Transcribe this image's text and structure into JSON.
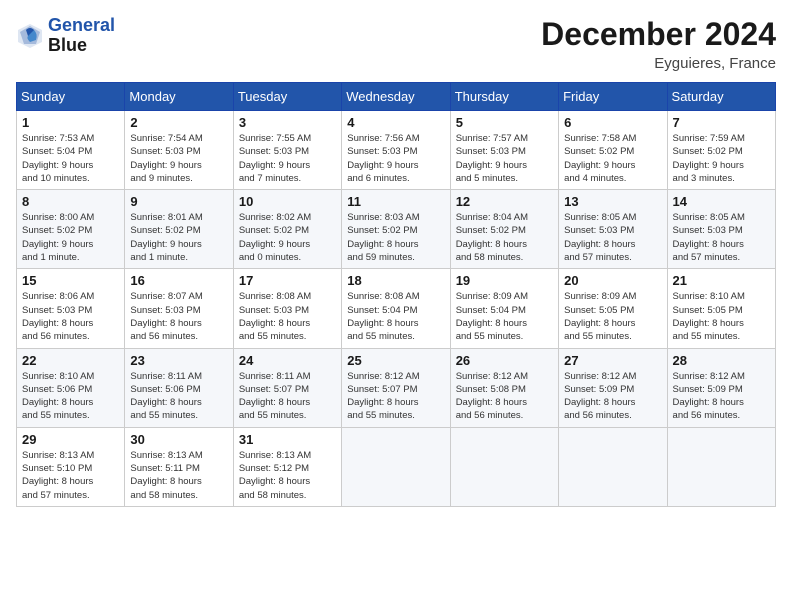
{
  "header": {
    "logo_line1": "General",
    "logo_line2": "Blue",
    "month_year": "December 2024",
    "location": "Eyguieres, France"
  },
  "weekdays": [
    "Sunday",
    "Monday",
    "Tuesday",
    "Wednesday",
    "Thursday",
    "Friday",
    "Saturday"
  ],
  "weeks": [
    [
      {
        "day": "1",
        "info": "Sunrise: 7:53 AM\nSunset: 5:04 PM\nDaylight: 9 hours\nand 10 minutes."
      },
      {
        "day": "2",
        "info": "Sunrise: 7:54 AM\nSunset: 5:03 PM\nDaylight: 9 hours\nand 9 minutes."
      },
      {
        "day": "3",
        "info": "Sunrise: 7:55 AM\nSunset: 5:03 PM\nDaylight: 9 hours\nand 7 minutes."
      },
      {
        "day": "4",
        "info": "Sunrise: 7:56 AM\nSunset: 5:03 PM\nDaylight: 9 hours\nand 6 minutes."
      },
      {
        "day": "5",
        "info": "Sunrise: 7:57 AM\nSunset: 5:03 PM\nDaylight: 9 hours\nand 5 minutes."
      },
      {
        "day": "6",
        "info": "Sunrise: 7:58 AM\nSunset: 5:02 PM\nDaylight: 9 hours\nand 4 minutes."
      },
      {
        "day": "7",
        "info": "Sunrise: 7:59 AM\nSunset: 5:02 PM\nDaylight: 9 hours\nand 3 minutes."
      }
    ],
    [
      {
        "day": "8",
        "info": "Sunrise: 8:00 AM\nSunset: 5:02 PM\nDaylight: 9 hours\nand 1 minute."
      },
      {
        "day": "9",
        "info": "Sunrise: 8:01 AM\nSunset: 5:02 PM\nDaylight: 9 hours\nand 1 minute."
      },
      {
        "day": "10",
        "info": "Sunrise: 8:02 AM\nSunset: 5:02 PM\nDaylight: 9 hours\nand 0 minutes."
      },
      {
        "day": "11",
        "info": "Sunrise: 8:03 AM\nSunset: 5:02 PM\nDaylight: 8 hours\nand 59 minutes."
      },
      {
        "day": "12",
        "info": "Sunrise: 8:04 AM\nSunset: 5:02 PM\nDaylight: 8 hours\nand 58 minutes."
      },
      {
        "day": "13",
        "info": "Sunrise: 8:05 AM\nSunset: 5:03 PM\nDaylight: 8 hours\nand 57 minutes."
      },
      {
        "day": "14",
        "info": "Sunrise: 8:05 AM\nSunset: 5:03 PM\nDaylight: 8 hours\nand 57 minutes."
      }
    ],
    [
      {
        "day": "15",
        "info": "Sunrise: 8:06 AM\nSunset: 5:03 PM\nDaylight: 8 hours\nand 56 minutes."
      },
      {
        "day": "16",
        "info": "Sunrise: 8:07 AM\nSunset: 5:03 PM\nDaylight: 8 hours\nand 56 minutes."
      },
      {
        "day": "17",
        "info": "Sunrise: 8:08 AM\nSunset: 5:03 PM\nDaylight: 8 hours\nand 55 minutes."
      },
      {
        "day": "18",
        "info": "Sunrise: 8:08 AM\nSunset: 5:04 PM\nDaylight: 8 hours\nand 55 minutes."
      },
      {
        "day": "19",
        "info": "Sunrise: 8:09 AM\nSunset: 5:04 PM\nDaylight: 8 hours\nand 55 minutes."
      },
      {
        "day": "20",
        "info": "Sunrise: 8:09 AM\nSunset: 5:05 PM\nDaylight: 8 hours\nand 55 minutes."
      },
      {
        "day": "21",
        "info": "Sunrise: 8:10 AM\nSunset: 5:05 PM\nDaylight: 8 hours\nand 55 minutes."
      }
    ],
    [
      {
        "day": "22",
        "info": "Sunrise: 8:10 AM\nSunset: 5:06 PM\nDaylight: 8 hours\nand 55 minutes."
      },
      {
        "day": "23",
        "info": "Sunrise: 8:11 AM\nSunset: 5:06 PM\nDaylight: 8 hours\nand 55 minutes."
      },
      {
        "day": "24",
        "info": "Sunrise: 8:11 AM\nSunset: 5:07 PM\nDaylight: 8 hours\nand 55 minutes."
      },
      {
        "day": "25",
        "info": "Sunrise: 8:12 AM\nSunset: 5:07 PM\nDaylight: 8 hours\nand 55 minutes."
      },
      {
        "day": "26",
        "info": "Sunrise: 8:12 AM\nSunset: 5:08 PM\nDaylight: 8 hours\nand 56 minutes."
      },
      {
        "day": "27",
        "info": "Sunrise: 8:12 AM\nSunset: 5:09 PM\nDaylight: 8 hours\nand 56 minutes."
      },
      {
        "day": "28",
        "info": "Sunrise: 8:12 AM\nSunset: 5:09 PM\nDaylight: 8 hours\nand 56 minutes."
      }
    ],
    [
      {
        "day": "29",
        "info": "Sunrise: 8:13 AM\nSunset: 5:10 PM\nDaylight: 8 hours\nand 57 minutes."
      },
      {
        "day": "30",
        "info": "Sunrise: 8:13 AM\nSunset: 5:11 PM\nDaylight: 8 hours\nand 58 minutes."
      },
      {
        "day": "31",
        "info": "Sunrise: 8:13 AM\nSunset: 5:12 PM\nDaylight: 8 hours\nand 58 minutes."
      },
      {
        "day": "",
        "info": ""
      },
      {
        "day": "",
        "info": ""
      },
      {
        "day": "",
        "info": ""
      },
      {
        "day": "",
        "info": ""
      }
    ]
  ]
}
